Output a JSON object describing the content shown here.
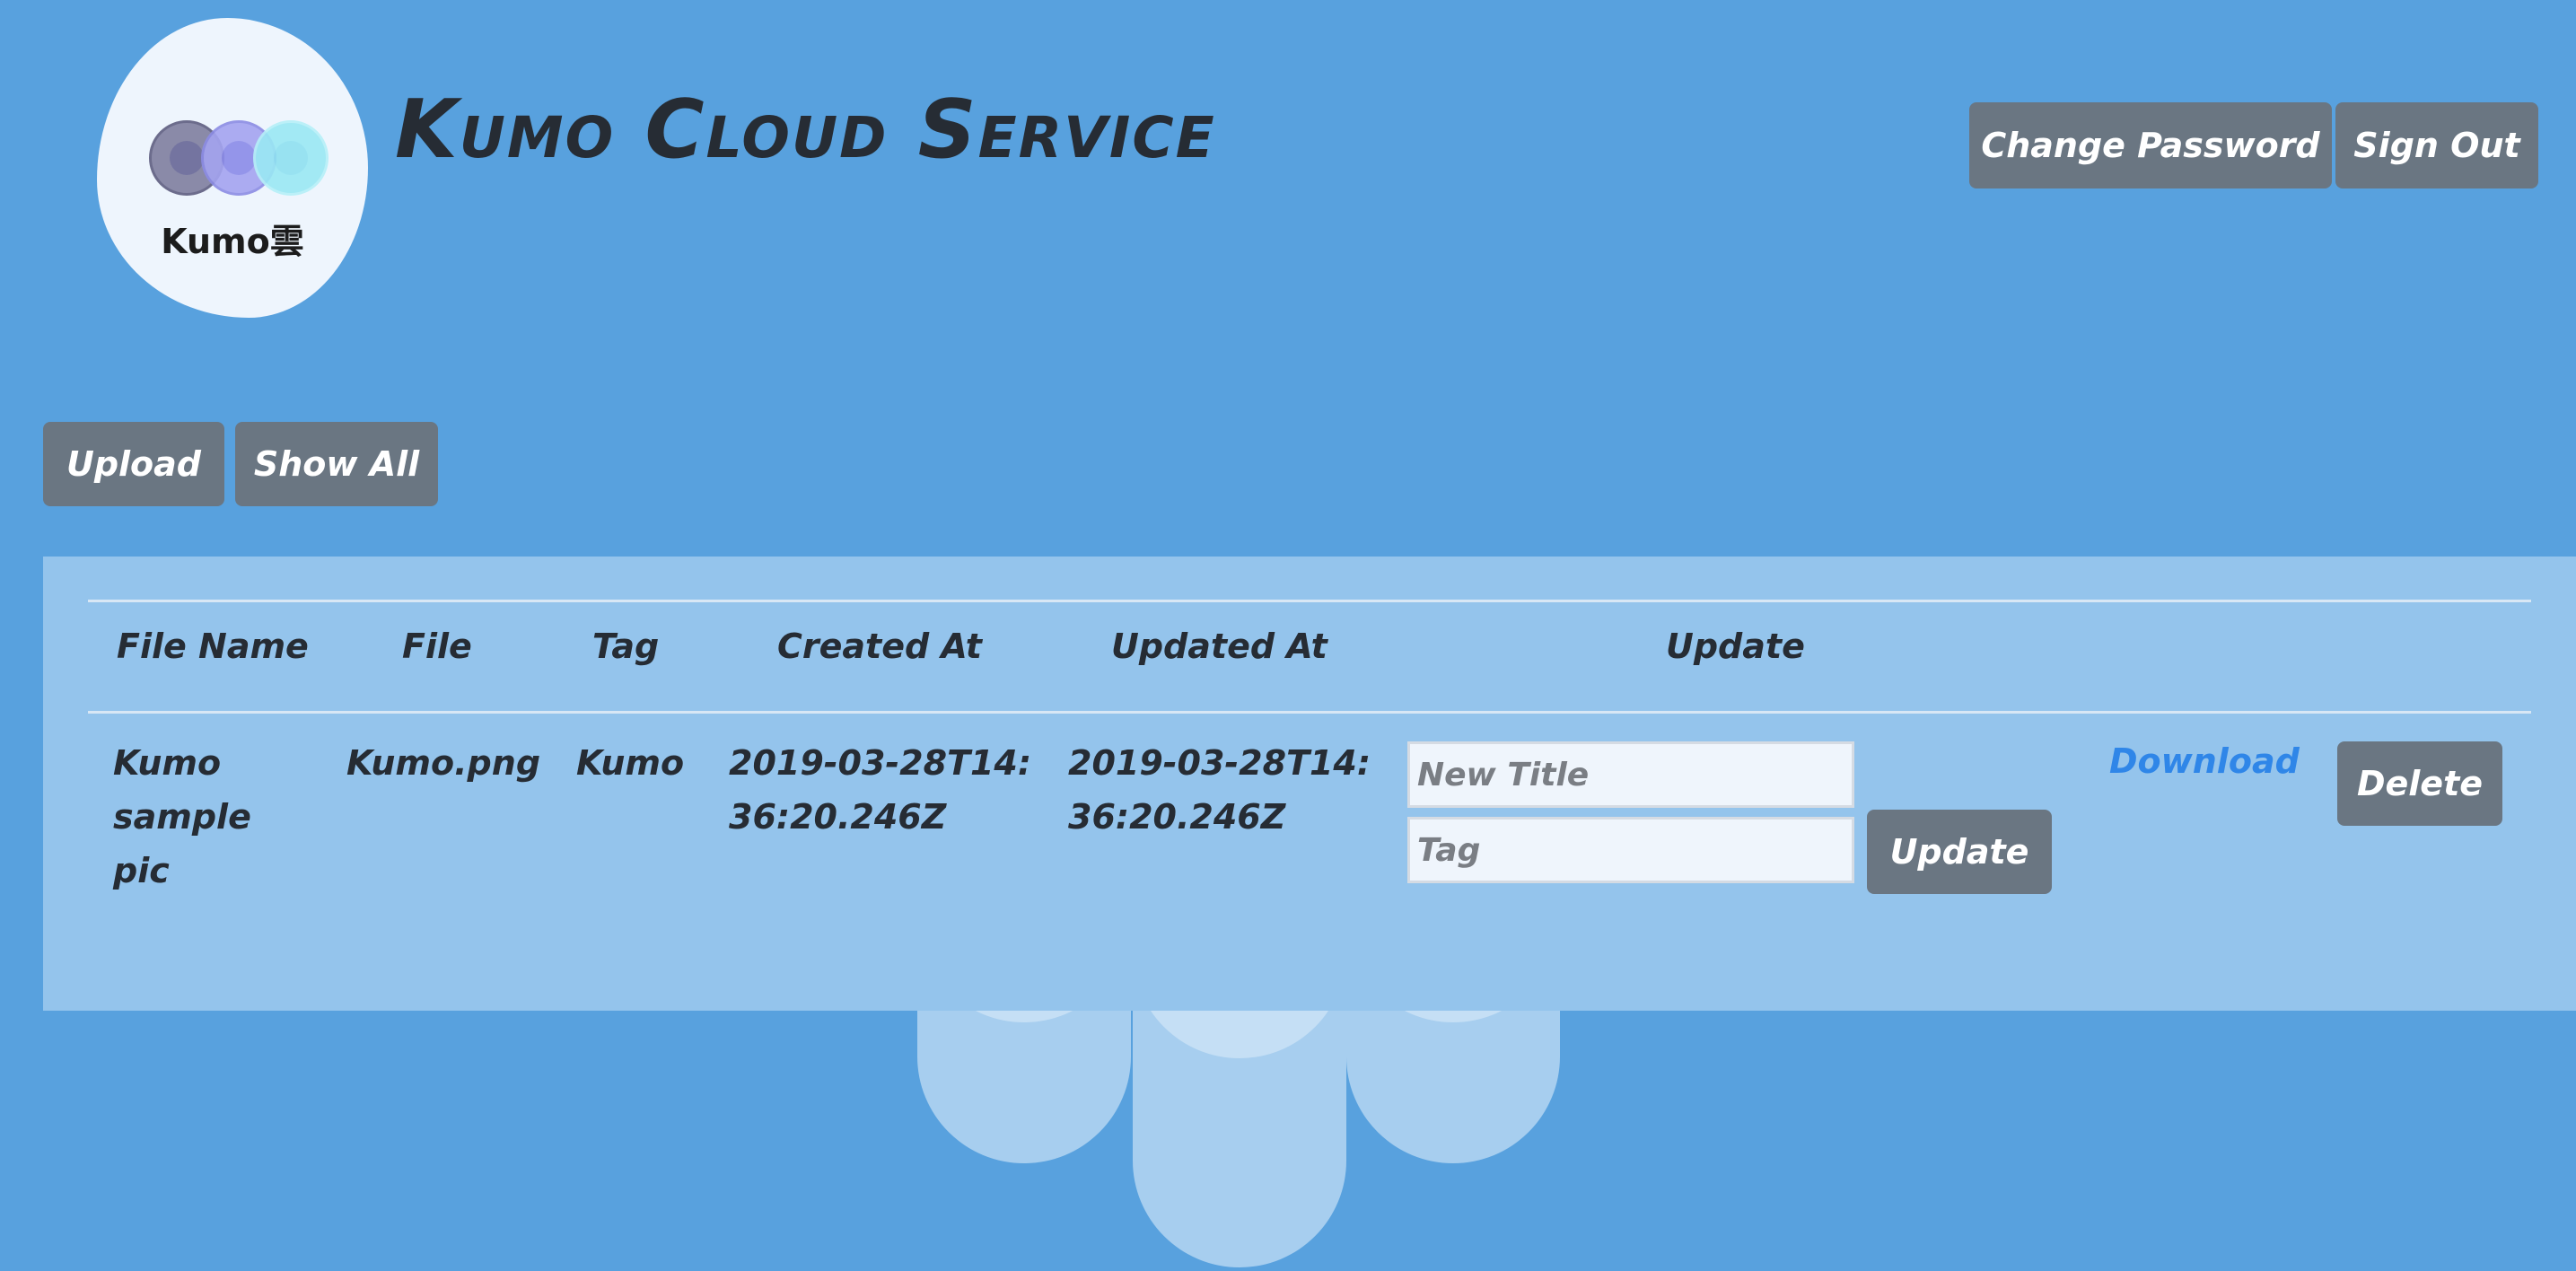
{
  "logo": {
    "text": "Kumo雲"
  },
  "header": {
    "title": "Kumo Cloud Service",
    "change_password_label": "Change Password",
    "sign_out_label": "Sign Out"
  },
  "toolbar": {
    "upload_label": "Upload",
    "show_all_label": "Show All"
  },
  "table": {
    "columns": [
      "File Name",
      "File",
      "Tag",
      "Created At",
      "Updated At",
      "Update"
    ],
    "rows": [
      {
        "file_name": "Kumo sample pic",
        "file": "Kumo.png",
        "tag": "Kumo",
        "created_at": "2019-03-28T14:36:20.246Z",
        "updated_at": "2019-03-28T14:36:20.246Z",
        "new_title_placeholder": "New Title",
        "tag_placeholder": "Tag",
        "update_label": "Update",
        "download_label": "Download",
        "delete_label": "Delete"
      }
    ]
  },
  "colors": {
    "background": "#58a1de",
    "panel": "#94c4ec",
    "button": "#6a7682",
    "link": "#2f86e8",
    "text": "#262c34"
  }
}
